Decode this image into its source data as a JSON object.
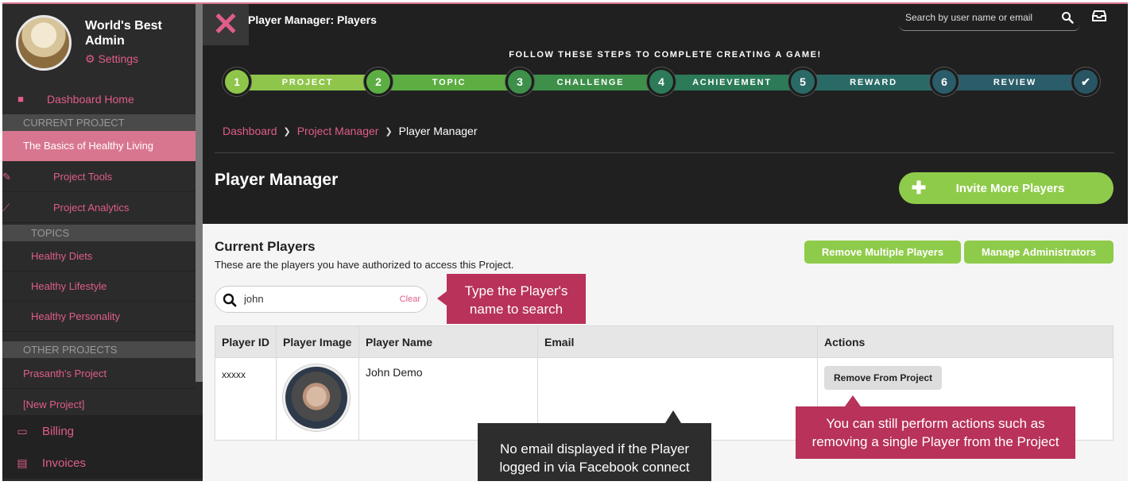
{
  "profile": {
    "name": "World's Best Admin",
    "settings_label": "Settings"
  },
  "sidebar": {
    "dashboard_home": "Dashboard Home",
    "current_project_header": "CURRENT PROJECT",
    "current_project": "The Basics of Healthy Living",
    "project_tools": "Project Tools",
    "project_analytics": "Project Analytics",
    "topics_header": "TOPICS",
    "topics": [
      "Healthy Diets",
      "Healthy Lifestyle",
      "Healthy Personality"
    ],
    "other_projects_header": "OTHER PROJECTS",
    "other_projects": [
      "Prasanth's Project",
      "[New Project]"
    ],
    "billing": "Billing",
    "invoices": "Invoices"
  },
  "topbar": {
    "title": "Player Manager: Players",
    "search_placeholder": "Search by user name or email"
  },
  "stepper": {
    "title": "FOLLOW THESE STEPS TO COMPLETE CREATING A GAME!",
    "steps": [
      {
        "num": "1",
        "label": "PROJECT",
        "color": "#8fc54a"
      },
      {
        "num": "2",
        "label": "TOPIC",
        "color": "#5cae43"
      },
      {
        "num": "3",
        "label": "CHALLENGE",
        "color": "#3d8f4a"
      },
      {
        "num": "4",
        "label": "ACHIEVEMENT",
        "color": "#2c7a58"
      },
      {
        "num": "5",
        "label": "REWARD",
        "color": "#2a6a66"
      },
      {
        "num": "6",
        "label": "REVIEW",
        "color": "#2b5c6a"
      }
    ],
    "final_color": "#285664"
  },
  "breadcrumb": {
    "items": [
      "Dashboard",
      "Project Manager"
    ],
    "current": "Player Manager"
  },
  "page": {
    "title": "Player Manager",
    "invite_button": "Invite More Players",
    "current_players_title": "Current Players",
    "current_players_sub": "These are the players you have authorized to access this Project.",
    "remove_multiple": "Remove Multiple Players",
    "manage_admins": "Manage Administrators",
    "search_value": "john",
    "clear_label": "Clear"
  },
  "table": {
    "headers": [
      "Player ID",
      "Player Image",
      "Player Name",
      "Email",
      "Actions"
    ],
    "rows": [
      {
        "id": "xxxxx",
        "name": "John Demo",
        "email": "",
        "action": "Remove From Project"
      }
    ]
  },
  "callouts": {
    "search_tip": "Type the Player's name to search",
    "email_tip": "No email displayed if the Player logged in via Facebook connect",
    "actions_tip": "You can still perform actions such as removing a single Player from the Project"
  },
  "colors": {
    "accent_pink": "#e05d8a",
    "green": "#8fcb4a",
    "callout_pink": "#b8325a"
  }
}
